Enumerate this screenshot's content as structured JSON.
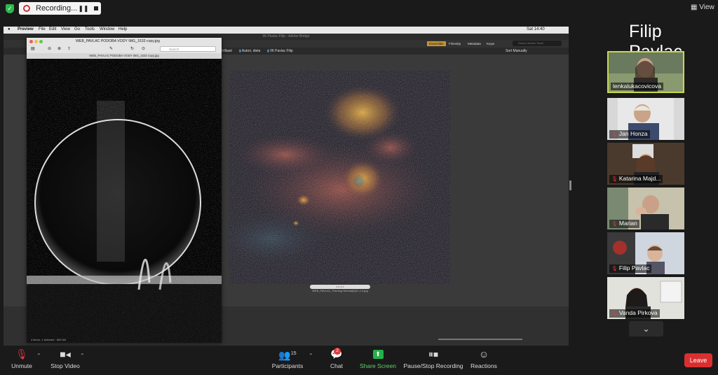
{
  "zoom_top": {
    "recording_label": "Recording...",
    "view_label": "View"
  },
  "shared_screen": {
    "menubar": {
      "apple": "",
      "app": "Preview",
      "items": [
        "File",
        "Edit",
        "View",
        "Go",
        "Tools",
        "Window",
        "Help"
      ],
      "clock": "Sat 14:40"
    },
    "bridge": {
      "window_title": "06 Pavlac Filip - Adobe Bridge",
      "tabs": [
        "Essentials",
        "Filmstrip",
        "Metadata",
        "Keyw"
      ],
      "search_placeholder": "Search Adobe Stock",
      "sort_label": "Sort Manually",
      "path": [
        "ArtVillasé",
        "Autori, diela",
        "06 Pavlac Filip"
      ],
      "caption": "• • • • •",
      "caption_sub": "WEB_PAVLAC_Flaming Nebula(6)01-2-3.jpg"
    },
    "preview": {
      "file_title": "WEB_PAVLAC PODOBA VODY IMG_1533 copy.jpg",
      "tab_title": "WEB_PAVLAC PODOBA VODY IMG_1533 copy.jpg",
      "search_placeholder": "Search",
      "status": "4 items, 1 selected · 683 KB"
    }
  },
  "speaker_name": "Filip Pavlac",
  "participants": [
    {
      "name": "lenkalukacovicova",
      "muted": false,
      "active": true
    },
    {
      "name": "Jan Honza",
      "muted": true,
      "active": false
    },
    {
      "name": "Katarina Majd...",
      "muted": true,
      "active": false
    },
    {
      "name": "Marian",
      "muted": true,
      "active": false
    },
    {
      "name": "Filip Pavlac",
      "muted": true,
      "active": false
    },
    {
      "name": "Vanda Pirkova",
      "muted": true,
      "active": false
    }
  ],
  "toolbar": {
    "unmute": "Unmute",
    "stop_video": "Stop Video",
    "participants": "Participants",
    "participants_count": "15",
    "chat": "Chat",
    "chat_badge": "2",
    "share_screen": "Share Screen",
    "pause_recording": "Pause/Stop Recording",
    "reactions": "Reactions",
    "leave": "Leave"
  },
  "colors": {
    "active_speaker_border": "#c8d94a",
    "leave_red": "#d9302f",
    "share_green": "#23b24a",
    "mute_red": "#e0393e"
  }
}
